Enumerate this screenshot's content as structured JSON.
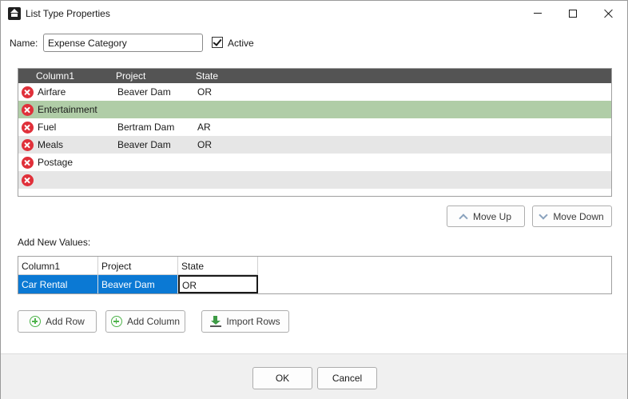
{
  "window": {
    "title": "List Type Properties"
  },
  "name_field": {
    "label": "Name:",
    "value": "Expense Category"
  },
  "active": {
    "label": "Active",
    "checked": true
  },
  "list_grid": {
    "columns": [
      "Column1",
      "Project",
      "State"
    ],
    "rows": [
      {
        "column1": "Airfare",
        "project": "Beaver Dam",
        "state": "OR",
        "selected": false
      },
      {
        "column1": "Entertainment",
        "project": "",
        "state": "",
        "selected": true
      },
      {
        "column1": "Fuel",
        "project": "Bertram Dam",
        "state": "AR",
        "selected": false
      },
      {
        "column1": "Meals",
        "project": "Beaver Dam",
        "state": "OR",
        "selected": false
      },
      {
        "column1": "Postage",
        "project": "",
        "state": "",
        "selected": false
      },
      {
        "column1": "",
        "project": "",
        "state": "",
        "selected": false
      }
    ]
  },
  "move_up_label": "Move Up",
  "move_down_label": "Move Down",
  "add_new_values_label": "Add New Values:",
  "new_values_grid": {
    "columns": [
      "Column1",
      "Project",
      "State"
    ],
    "row": {
      "column1": "Car Rental",
      "project": "Beaver Dam",
      "state": "OR"
    }
  },
  "add_row_label": "Add Row",
  "add_column_label": "Add Column",
  "import_rows_label": "Import Rows",
  "ok_label": "OK",
  "cancel_label": "Cancel",
  "colors": {
    "header_bg": "#545454",
    "row_alt": "#e6e6e6",
    "row_selected": "#b0cda7",
    "cell_selected": "#0b79d4",
    "delete_icon": "#e0303a",
    "add_icon": "#4db34a"
  }
}
